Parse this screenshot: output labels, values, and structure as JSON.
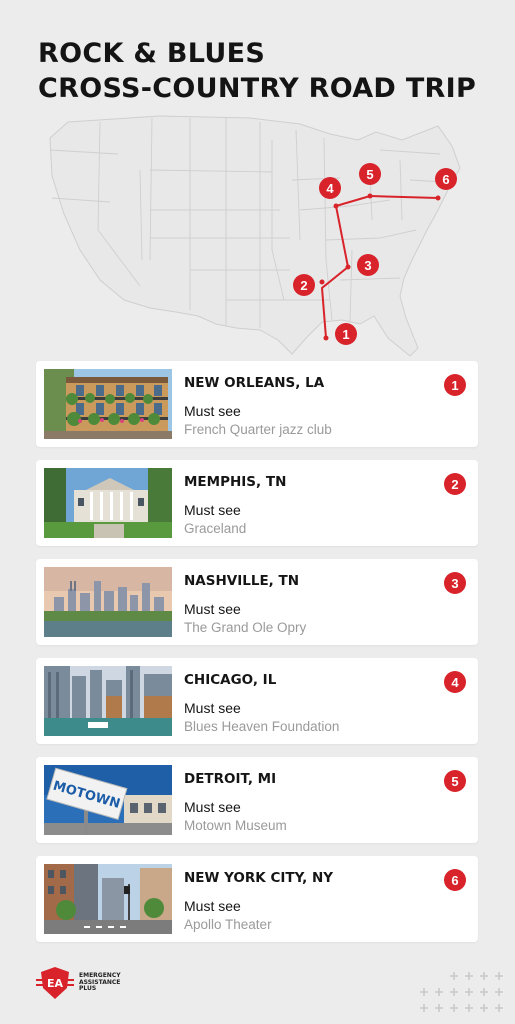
{
  "header": {
    "title_line1": "ROCK & BLUES",
    "title_line2": "CROSS-COUNTRY ROAD TRIP"
  },
  "map": {
    "route_color": "#d8232a",
    "markers": [
      "1",
      "2",
      "3",
      "4",
      "5",
      "6"
    ]
  },
  "stops": [
    {
      "number": "1",
      "city": "NEW ORLEANS, LA",
      "label": "Must see",
      "place": "French Quarter jazz club"
    },
    {
      "number": "2",
      "city": "MEMPHIS, TN",
      "label": "Must see",
      "place": "Graceland"
    },
    {
      "number": "3",
      "city": "NASHVILLE, TN",
      "label": "Must see",
      "place": "The Grand Ole Opry"
    },
    {
      "number": "4",
      "city": "CHICAGO, IL",
      "label": "Must see",
      "place": "Blues Heaven Foundation"
    },
    {
      "number": "5",
      "city": "DETROIT, MI",
      "label": "Must see",
      "place": "Motown Museum"
    },
    {
      "number": "6",
      "city": "NEW YORK CITY, NY",
      "label": "Must see",
      "place": "Apollo Theater"
    }
  ],
  "photo_texts": {
    "motown_sign": "MOTOWN"
  },
  "footer": {
    "logo_mark": "EA",
    "logo_line1": "EMERGENCY",
    "logo_line2": "ASSISTANCE",
    "logo_line3": "PLUS"
  },
  "colors": {
    "accent": "#d8232a",
    "background": "#ececec",
    "card": "#ffffff"
  }
}
